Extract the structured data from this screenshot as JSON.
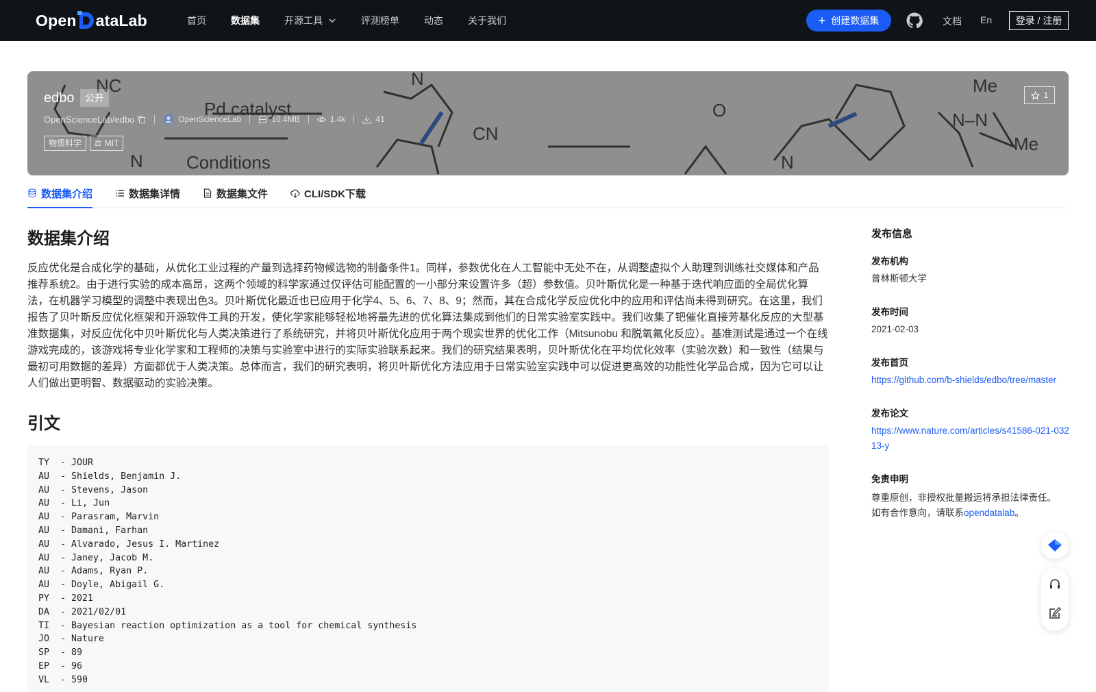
{
  "nav": {
    "logo_text_left": "Open",
    "logo_text_right": "ataLab",
    "links": [
      "首页",
      "数据集",
      "开源工具",
      "评测榜单",
      "动态",
      "关于我们"
    ],
    "create_label": "创建数据集",
    "docs_label": "文档",
    "lang_label": "En",
    "login_label": "登录 / 注册"
  },
  "banner": {
    "title": "edbo",
    "visibility": "公开",
    "path": "OpenScienceLab/edbo",
    "owner": "OpenScienceLab",
    "size": "10.4MB",
    "views": "1.4k",
    "downloads": "41",
    "tags": [
      "物质科学",
      "MIT"
    ],
    "stars": "1"
  },
  "tabs": [
    "数据集介绍",
    "数据集详情",
    "数据集文件",
    "CLI/SDK下载"
  ],
  "intro": {
    "heading": "数据集介绍",
    "body": "反应优化是合成化学的基础，从优化工业过程的产量到选择药物候选物的制备条件1。同样，参数优化在人工智能中无处不在，从调整虚拟个人助理到训练社交媒体和产品推荐系统2。由于进行实验的成本高昂，这两个领域的科学家通过仅评估可能配置的一小部分来设置许多（超）参数值。贝叶斯优化是一种基于迭代响应面的全局优化算法，在机器学习模型的调整中表现出色3。贝叶斯优化最近也已应用于化学4、5、6、7、8、9；然而，其在合成化学反应优化中的应用和评估尚未得到研究。在这里，我们报告了贝叶斯反应优化框架和开源软件工具的开发，使化学家能够轻松地将最先进的优化算法集成到他们的日常实验室实践中。我们收集了钯催化直接芳基化反应的大型基准数据集，对反应优化中贝叶斯优化与人类决策进行了系统研究，并将贝叶斯优化应用于两个现实世界的优化工作（Mitsunobu 和脱氧氟化反应）。基准测试是通过一个在线游戏完成的，该游戏将专业化学家和工程师的决策与实验室中进行的实际实验联系起来。我们的研究结果表明，贝叶斯优化在平均优化效率（实验次数）和一致性（结果与最初可用数据的差异）方面都优于人类决策。总体而言，我们的研究表明，将贝叶斯优化方法应用于日常实验室实践中可以促进更高效的功能性化学品合成，因为它可以让人们做出更明智、数据驱动的实验决策。"
  },
  "citation": {
    "heading": "引文",
    "lines": [
      "TY  - JOUR",
      "AU  - Shields, Benjamin J.",
      "AU  - Stevens, Jason",
      "AU  - Li, Jun",
      "AU  - Parasram, Marvin",
      "AU  - Damani, Farhan",
      "AU  - Alvarado, Jesus I. Martinez",
      "AU  - Janey, Jacob M.",
      "AU  - Adams, Ryan P.",
      "AU  - Doyle, Abigail G.",
      "PY  - 2021",
      "DA  - 2021/02/01",
      "TI  - Bayesian reaction optimization as a tool for chemical synthesis",
      "JO  - Nature",
      "SP  - 89",
      "EP  - 96",
      "VL  - 590"
    ]
  },
  "sidebar": {
    "title": "发布信息",
    "org_label": "发布机构",
    "org_value": "普林斯顿大学",
    "date_label": "发布时间",
    "date_value": "2021-02-03",
    "home_label": "发布首页",
    "home_value": "https://github.com/b-shields/edbo/tree/master",
    "paper_label": "发布论文",
    "paper_value": "https://www.nature.com/articles/s41586-021-03213-y",
    "disclaimer_label": "免责申明",
    "disclaimer_line1": "尊重原创，非授权批量搬运将承担法律责任。",
    "disclaimer_line2_prefix": "如有合作意向，请联系",
    "disclaimer_link": "opendatalab",
    "disclaimer_suffix": "。"
  },
  "colors": {
    "nav_bg": "#0f1418",
    "accent": "#1b5cf5"
  }
}
